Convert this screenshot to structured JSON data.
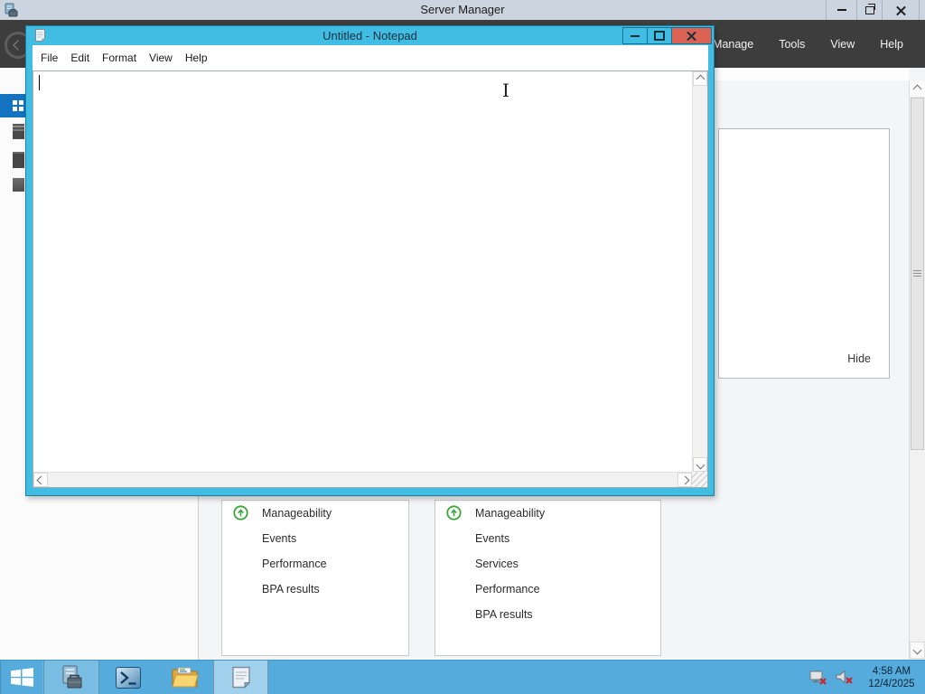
{
  "colors": {
    "notepad_frame_blue": "#41bde4",
    "notepad_close_red": "#dc6254",
    "taskbar_blue": "#55abdc",
    "selected_nav_blue": "#1473c0",
    "status_green": "#3aa73a",
    "dark_menubar": "#3d3d3d",
    "sm_titlebar_gray": "#ccd5df"
  },
  "server_manager": {
    "window_title": "Server Manager",
    "nav_menu": {
      "items": [
        {
          "label": "Manage"
        },
        {
          "label": "Tools"
        },
        {
          "label": "View"
        },
        {
          "label": "Help"
        }
      ]
    },
    "flyout": {
      "hide_label": "Hide"
    },
    "dashboard_tiles": [
      {
        "status_icon": "up-arrow-circle-green",
        "rows": [
          "Manageability",
          "Events",
          "Performance",
          "BPA results"
        ]
      },
      {
        "status_icon": "up-arrow-circle-green",
        "rows": [
          "Manageability",
          "Events",
          "Services",
          "Performance",
          "BPA results"
        ]
      }
    ]
  },
  "notepad": {
    "window_title": "Untitled - Notepad",
    "menu": {
      "items": [
        {
          "label": "File"
        },
        {
          "label": "Edit"
        },
        {
          "label": "Format"
        },
        {
          "label": "View"
        },
        {
          "label": "Help"
        }
      ]
    },
    "editor_text": ""
  },
  "taskbar": {
    "clock": {
      "time": "4:58 AM",
      "date": "12/4/2025"
    },
    "buttons": [
      {
        "name": "start"
      },
      {
        "name": "server-manager",
        "state": "running"
      },
      {
        "name": "powershell",
        "state": "pinned"
      },
      {
        "name": "file-explorer",
        "state": "pinned"
      },
      {
        "name": "notepad",
        "state": "active"
      }
    ]
  },
  "icons": {
    "start": "windows-logo",
    "server_manager": "server-with-toolbox",
    "powershell": "blue-prompt-window",
    "file_explorer": "yellow-folder",
    "notepad": "notepad-pad",
    "network_tray": "network-disconnected-red-x",
    "audio_tray": "speaker-muted-red-x",
    "tile_status": "green-up-arrow-circle",
    "back_nav": "back-circle-arrow"
  }
}
